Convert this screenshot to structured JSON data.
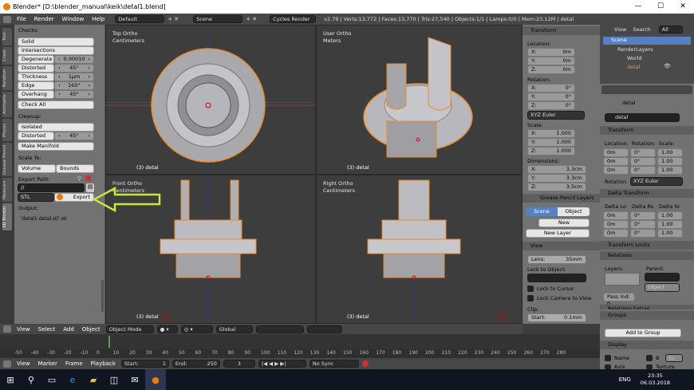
{
  "title": "Blender* [D:\\blender_manual\\keik\\detal1.blend]",
  "window_controls": {
    "min": "—",
    "max": "☐",
    "close": "✕"
  },
  "topbar": {
    "menus": [
      "File",
      "Render",
      "Window",
      "Help"
    ],
    "layout": "Default",
    "scene": "Scene",
    "engine": "Cycles Render",
    "info": "v2.79 | Verts:13,772 | Faces:13,770 | Tris:27,540 | Objects:1/1 | Lamps:0/0 | Mem:23.12M | detal"
  },
  "left_tabs": [
    "Tool",
    "Creat",
    "Relation",
    "Animatio",
    "Physic",
    "Grease Pencil",
    "Measure",
    "3D Printin"
  ],
  "toolshelf": {
    "checks_title": "Checks:",
    "solid": "Solid",
    "intersections": "Intersections",
    "degenerate": {
      "label": "Degenerate",
      "value": "0.00010"
    },
    "distorted": {
      "label": "Distorted",
      "value": "45°"
    },
    "thickness": {
      "label": "Thickness",
      "value": "1μm"
    },
    "edge_sharp": {
      "label": "Edge Sharp",
      "value": "160°"
    },
    "overhang": {
      "label": "Overhang",
      "value": "45°"
    },
    "check_all": "Check All",
    "cleanup_title": "Cleanup:",
    "isolated": "Isolated",
    "distorted2": {
      "label": "Distorted",
      "value": "45°"
    },
    "make_manifold": "Make Manifold",
    "scale_to_title": "Scale To:",
    "volume": "Volume",
    "bounds": "Bounds",
    "export_path_title": "Export Path:",
    "export_path": "//",
    "format": "STL",
    "export": "Export",
    "output_title": "Output:",
    "output": "'detal1-detal.stl' ok"
  },
  "viewports": [
    {
      "name": "Top Ortho",
      "unit": "Centimeters",
      "object": "(3) detal"
    },
    {
      "name": "User Ortho",
      "unit": "Meters",
      "object": "(3) detal"
    },
    {
      "name": "Front Ortho",
      "unit": "Centimeters",
      "object": "(3) detal"
    },
    {
      "name": "Right Ortho",
      "unit": "Centimeters",
      "object": "(3) detal"
    }
  ],
  "transform": {
    "title": "Transform",
    "location": "Location:",
    "loc": [
      "X:",
      "Y:",
      "Z:"
    ],
    "loc_vals": [
      "0m",
      "0m",
      "0m"
    ],
    "rotation": "Rotation:",
    "rot": [
      "X:",
      "Y:",
      "Z:"
    ],
    "rot_vals": [
      "0°",
      "0°",
      "0°"
    ],
    "euler": "XYZ Euler",
    "scale": "Scale:",
    "scl": [
      "X:",
      "Y:",
      "Z:"
    ],
    "scl_vals": [
      "1.000",
      "1.000",
      "1.000"
    ],
    "dimensions": "Dimensions:",
    "dim": [
      "X:",
      "Y:",
      "Z:"
    ],
    "dim_vals": [
      "3.3cm",
      "3.3cm",
      "3.5cm"
    ]
  },
  "grease": {
    "title": "Grease Pencil Layers",
    "scene": "Scene",
    "object": "Object",
    "new": "New",
    "new_layer": "New Layer"
  },
  "view_panel": {
    "title": "View",
    "lens": "Lens:",
    "lens_val": "35mm",
    "lock_to_object": "Lock to Object:",
    "lock_cursor": "Lock to Cursor",
    "lock_camera": "Lock Camera to View",
    "clip": "Clip:",
    "clip_start": "Start:",
    "clip_start_val": "0.1mm"
  },
  "outliner": {
    "view": "View",
    "search": "Search",
    "all_scenes": "All Scenes",
    "items": [
      "Scene",
      "RenderLayers",
      "World",
      "detal"
    ]
  },
  "props": {
    "object_name": "detal",
    "name_field": "detal",
    "transform": "Transform",
    "location": "Location:",
    "rotation": "Rotation:",
    "scale": "Scale:",
    "rows": [
      [
        "0m",
        "0°",
        "1.00"
      ],
      [
        "0m",
        "0°",
        "1.00"
      ],
      [
        "0m",
        "0°",
        "1.00"
      ]
    ],
    "rot_mode_label": "Rotation",
    "rot_mode": "XYZ Euler",
    "delta_transform": "Delta Transform",
    "delta_cols": [
      "Delta Lo",
      "Delta Ro",
      "Delta Sc"
    ],
    "delta_rows": [
      [
        "0m",
        "0°",
        "1.00"
      ],
      [
        "0m",
        "0°",
        "1.00"
      ],
      [
        "0m",
        "0°",
        "1.00"
      ]
    ],
    "transform_locks": "Transform Locks",
    "relations": "Relations",
    "layers": "Layers:",
    "parent": "Parent:",
    "parent_type": "Object",
    "pass_index": "Pass Ind: 0",
    "relations_extras": "Relations Extras",
    "groups": "Groups",
    "add_to_group": "Add to Group",
    "display": "Display",
    "disp_name": "Name",
    "disp_b": "B",
    "disp_bo": "Bo",
    "disp_axis": "Axis",
    "disp_texture": "Texture"
  },
  "vpheader": {
    "view": "View",
    "select": "Select",
    "add": "Add",
    "object": "Object",
    "mode": "Object Mode",
    "orient": "Global"
  },
  "timeline": {
    "ticks": [
      "-50",
      "-40",
      "-30",
      "-20",
      "-10",
      "0",
      "10",
      "20",
      "30",
      "40",
      "50",
      "60",
      "70",
      "80",
      "90",
      "100",
      "110",
      "120",
      "130",
      "140",
      "150",
      "160",
      "170",
      "180",
      "190",
      "200",
      "210",
      "220",
      "230",
      "240",
      "250",
      "260",
      "270",
      "280"
    ]
  },
  "tlfooter": {
    "view": "View",
    "marker": "Marker",
    "frame": "Frame",
    "playback": "Playback",
    "start": "Start:",
    "start_val": "1",
    "end": "End:",
    "end_val": "250",
    "current": "3",
    "sync": "No Sync"
  },
  "taskbar": {
    "lang": "ENG",
    "time": "23:35",
    "date": "06.03.2018"
  }
}
